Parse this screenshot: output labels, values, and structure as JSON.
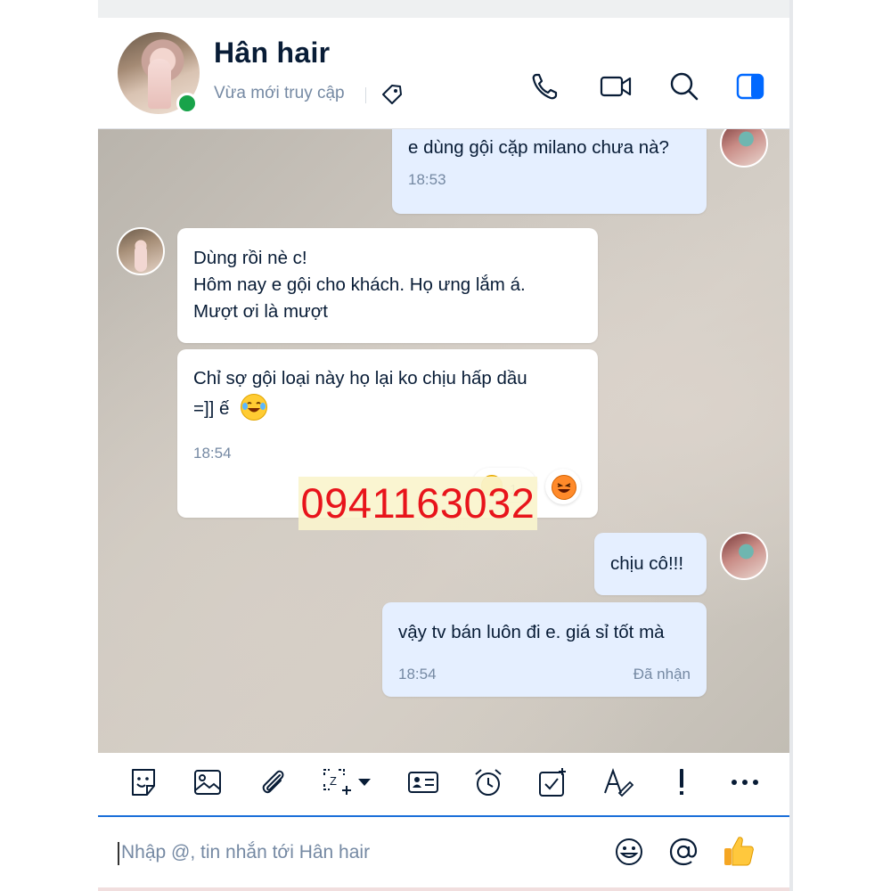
{
  "header": {
    "contact_name": "Hân hair",
    "status": "Vừa mới truy cập",
    "icons": [
      "tag-icon",
      "phone-icon",
      "video-call-icon",
      "search-icon",
      "sidebar-toggle-icon"
    ]
  },
  "messages": [
    {
      "direction": "out",
      "text": [
        "e dùng gội cặp milano chưa nà?"
      ],
      "time": "18:53"
    },
    {
      "direction": "in",
      "text": [
        "Dùng rồi nè c!",
        "Hôm nay e gội cho khách. Họ ưng lắm á.",
        "Mượt ơi là mượt"
      ]
    },
    {
      "direction": "in",
      "text": [
        "Chỉ sợ gội loại này họ lại ko chịu hấp dầu",
        "=]] ế"
      ],
      "emoji": "laughing-tears-emoji",
      "time": "18:54",
      "reaction_count": "1"
    },
    {
      "direction": "out",
      "text": [
        "chịu cô!!!"
      ]
    },
    {
      "direction": "out",
      "text": [
        "vậy tv bán luôn đi e. giá sỉ tốt mà"
      ],
      "time": "18:54",
      "receipt": "Đã nhận"
    }
  ],
  "overlay": {
    "phone_number": "0941163032"
  },
  "toolbar": {
    "icons": [
      "sticker-icon",
      "image-icon",
      "attachment-icon",
      "screenshot-icon",
      "contact-card-icon",
      "reminder-icon",
      "task-icon",
      "text-format-icon",
      "urgent-icon",
      "more-icon"
    ]
  },
  "composer": {
    "placeholder": "Nhập @, tin nhắn tới Hân hair",
    "icons": [
      "emoji-icon",
      "mention-icon",
      "thumbs-up-icon"
    ]
  },
  "colors": {
    "out_bubble": "#e5efff",
    "in_bubble": "#ffffff",
    "accent": "#0068ff",
    "online": "#18a34a",
    "overlay_text": "#e8141b"
  }
}
